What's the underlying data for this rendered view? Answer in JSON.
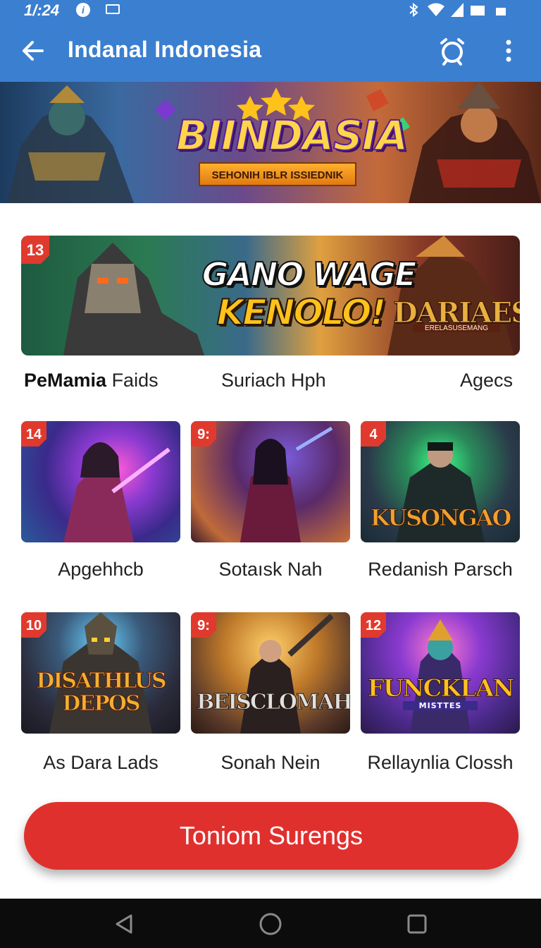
{
  "status_bar": {
    "time": "1/:24",
    "info_glyph": "i",
    "icons": [
      "info-icon",
      "message-icon",
      "bluetooth-icon",
      "wifi-icon",
      "signal-icon",
      "sim-icon",
      "battery-icon"
    ]
  },
  "app_bar": {
    "title": "Indanal Indonesia",
    "back_icon": "arrow-left-icon",
    "actions": [
      "alarm-clock-icon",
      "more-vert-icon"
    ]
  },
  "hero": {
    "title": "BIINDASIA",
    "subtitle": "SEHONIH IBLR ISSIEDNIK"
  },
  "featured": {
    "rank": "13",
    "headline_line1": "GANO WAGE",
    "headline_line2": "KENOLO!",
    "logo": "DARIAESA",
    "logo_sub": "ERELASUSEMANG",
    "captions": {
      "left_bold": "PeMamia",
      "left_rest": " Faids",
      "center": "Suriach Hph",
      "right": "Agecs"
    }
  },
  "games": [
    {
      "rank": "14",
      "logo": "",
      "caption": "Apgehhcb"
    },
    {
      "rank": "9:",
      "logo": "",
      "caption": "Sotaısk Nah"
    },
    {
      "rank": "4",
      "logo": "KUSONGAO",
      "caption": "Redanish Parsch"
    },
    {
      "rank": "10",
      "logo": "DISATHLUS DEPOS",
      "caption": "As Dara Lads"
    },
    {
      "rank": "9:",
      "logo": "BEISCLOMAH",
      "caption": "Sonah Nein"
    },
    {
      "rank": "12",
      "logo": "FUNCKLAN",
      "logo_sub": "MISTTES",
      "caption": "Rellaynlia Clossh"
    }
  ],
  "cta": {
    "label": "Toniom Surengs"
  },
  "colors": {
    "app_bar": "#3b7fd0",
    "badge": "#e03a2e",
    "cta": "#e0302e",
    "nav_bar": "#0c0c0c"
  },
  "nav": [
    "nav-back-icon",
    "nav-home-icon",
    "nav-recents-icon"
  ]
}
